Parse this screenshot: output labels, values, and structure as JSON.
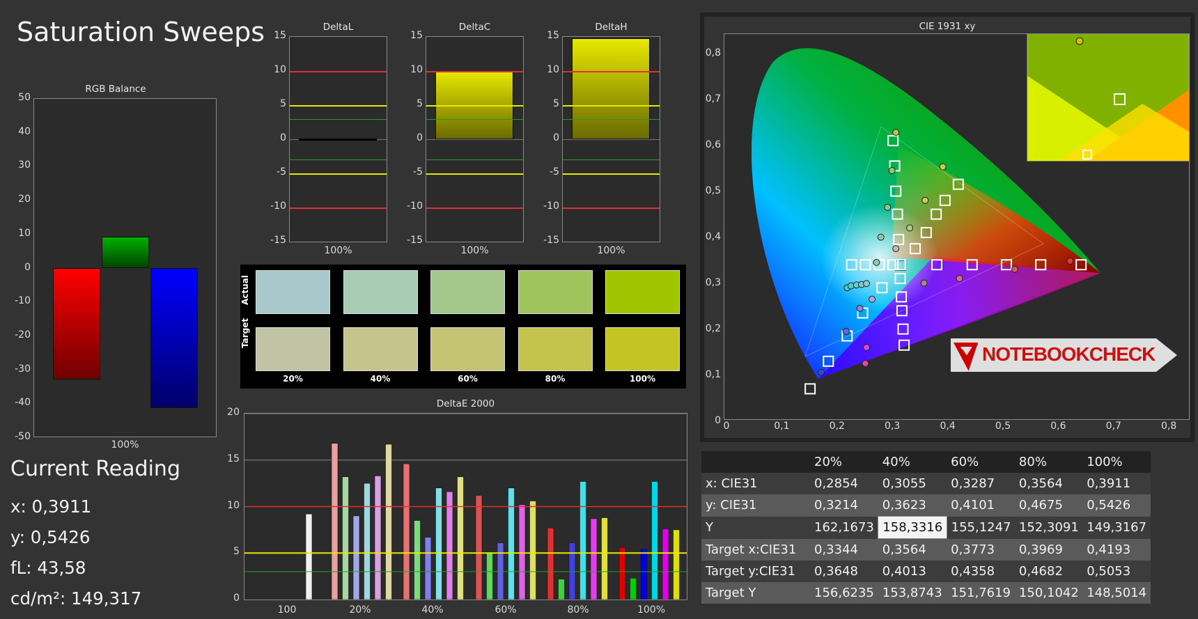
{
  "title": "Saturation Sweeps",
  "rgb_balance": {
    "title": "RGB Balance",
    "x_label": "100%",
    "y_ticks": [
      "50",
      "40",
      "30",
      "20",
      "10",
      "0",
      "-10",
      "-20",
      "-30",
      "-40",
      "-50"
    ]
  },
  "deltas": {
    "panels": [
      {
        "title": "DeltaL",
        "x_label": "100%"
      },
      {
        "title": "DeltaC",
        "x_label": "100%"
      },
      {
        "title": "DeltaH",
        "x_label": "100%"
      }
    ],
    "y_ticks": [
      "15",
      "10",
      "5",
      "0",
      "-5",
      "-10",
      "-15"
    ]
  },
  "swatches": {
    "actual_label": "Actual",
    "target_label": "Target",
    "labels": [
      "20%",
      "40%",
      "60%",
      "80%",
      "100%"
    ],
    "actual_colors": [
      "#a8c8cc",
      "#a8ccb4",
      "#a4c88c",
      "#a0c45c",
      "#a0c400"
    ],
    "target_colors": [
      "#c0c4a4",
      "#c4c48c",
      "#c4c474",
      "#c4c44c",
      "#c4c424"
    ]
  },
  "deltae": {
    "title": "DeltaE 2000",
    "x_labels": [
      "100",
      "20%",
      "40%",
      "60%",
      "80%",
      "100%"
    ],
    "y_ticks": [
      "20",
      "15",
      "10",
      "5",
      "0"
    ]
  },
  "cie": {
    "title": "CIE 1931 xy",
    "x_ticks": [
      "0",
      "0,1",
      "0,2",
      "0,3",
      "0,4",
      "0,5",
      "0,6",
      "0,7",
      "0,8"
    ],
    "y_ticks": [
      "0,8",
      "0,7",
      "0,6",
      "0,5",
      "0,4",
      "0,3",
      "0,2",
      "0,1",
      "0"
    ]
  },
  "watermark": "NOTEBOOKCHECK",
  "current_reading": {
    "heading": "Current Reading",
    "x": "x: 0,3911",
    "y": "y: 0,5426",
    "fl": "fL: 43,58",
    "cdm2": "cd/m²: 149,317"
  },
  "table": {
    "columns": [
      "20%",
      "40%",
      "60%",
      "80%",
      "100%"
    ],
    "rows": [
      {
        "label": "x: CIE31",
        "values": [
          "0,2854",
          "0,3055",
          "0,3287",
          "0,3564",
          "0,3911"
        ]
      },
      {
        "label": "y: CIE31",
        "values": [
          "0,3214",
          "0,3623",
          "0,4101",
          "0,4675",
          "0,5426"
        ]
      },
      {
        "label": "Y",
        "values": [
          "162,1673",
          "158,3316",
          "155,1247",
          "152,3091",
          "149,3167"
        ]
      },
      {
        "label": "Target x:CIE31",
        "values": [
          "0,3344",
          "0,3564",
          "0,3773",
          "0,3969",
          "0,4193"
        ]
      },
      {
        "label": "Target y:CIE31",
        "values": [
          "0,3648",
          "0,4013",
          "0,4358",
          "0,4682",
          "0,5053"
        ]
      },
      {
        "label": "Target Y",
        "values": [
          "156,6235",
          "153,8743",
          "151,7619",
          "150,1042",
          "148,5014"
        ]
      }
    ]
  },
  "colors": {
    "red_line": "#e03030",
    "yellow_line": "#e8e800",
    "green_line": "#20a020",
    "red_bar": "#ff0000",
    "green_bar": "#00aa00",
    "blue_bar": "#0000ff"
  }
}
